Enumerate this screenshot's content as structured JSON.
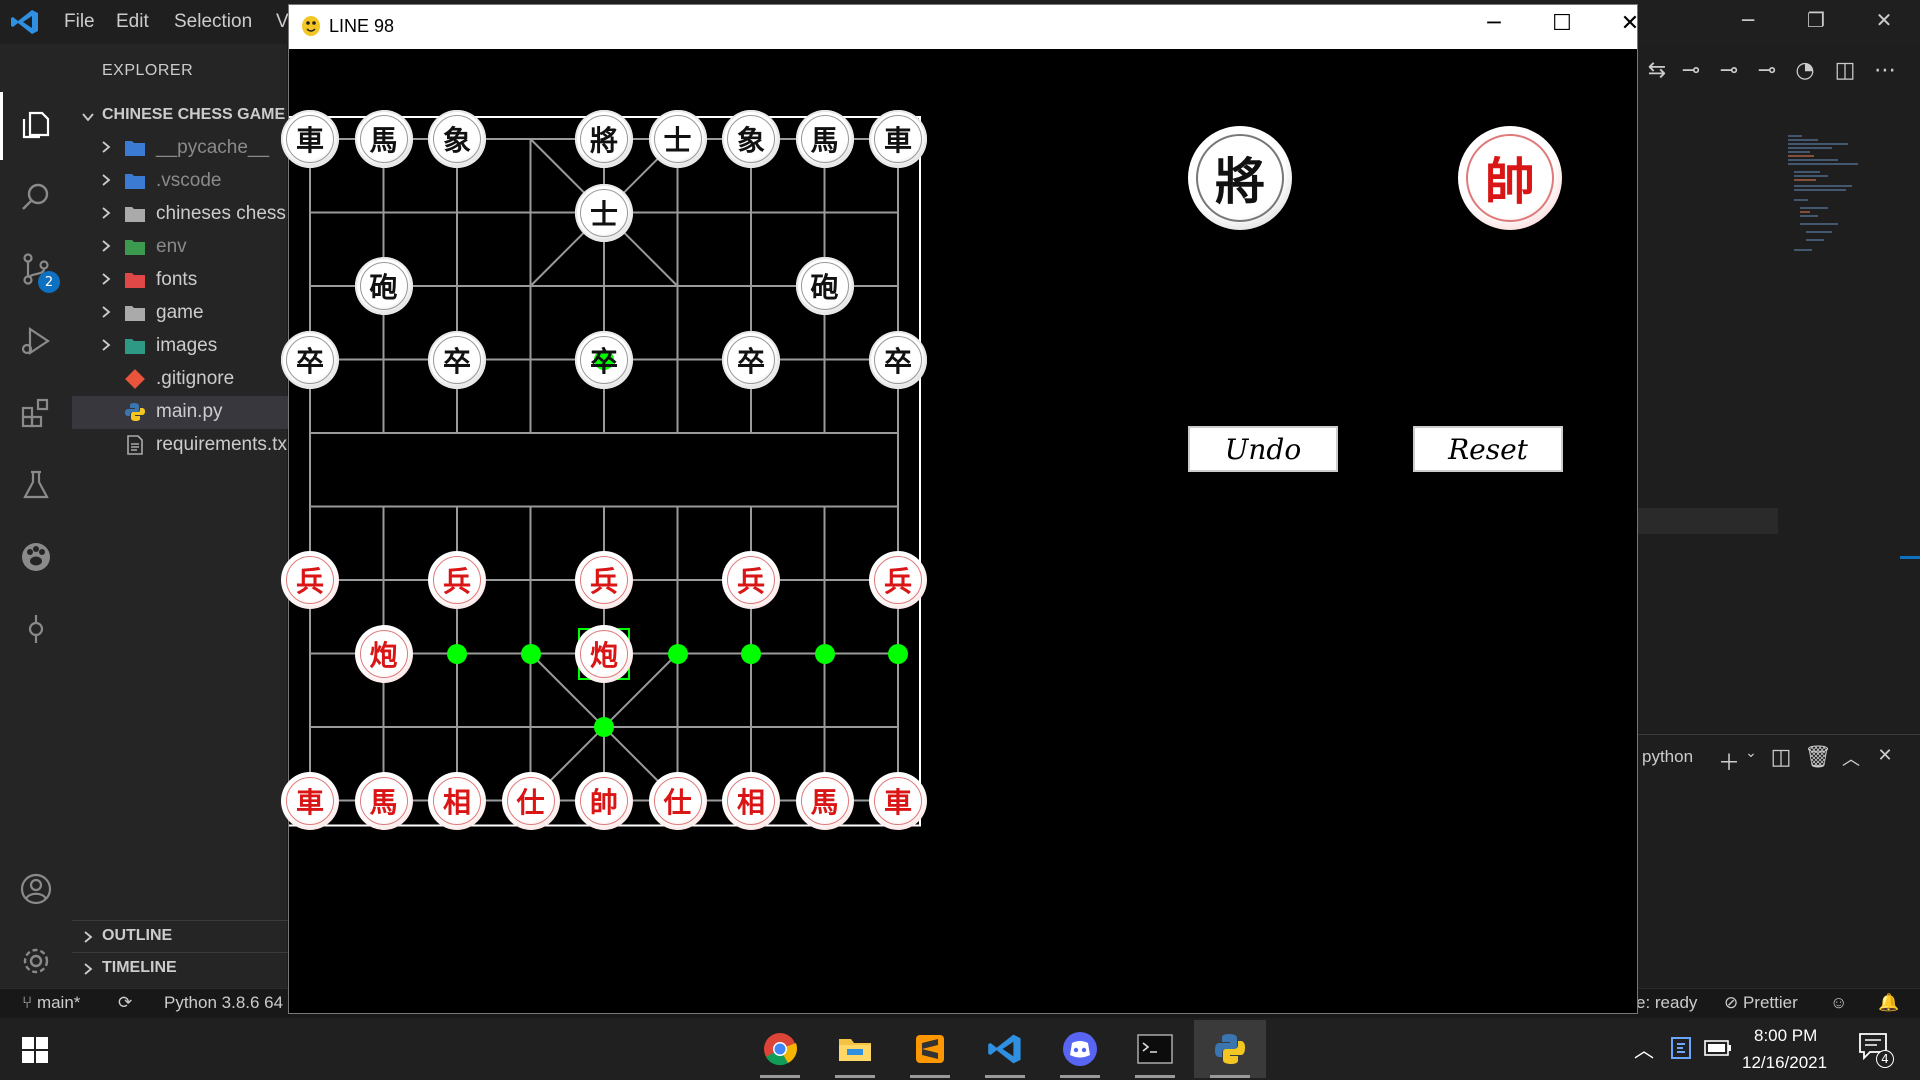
{
  "vscode": {
    "menu": [
      "File",
      "Edit",
      "Selection",
      "V"
    ],
    "explorer_title": "EXPLORER",
    "folder_name": "CHINESE CHESS GAME",
    "tree": [
      {
        "label": "__pycache__",
        "icon": "folder-python-icon",
        "color": "#8a8a8a"
      },
      {
        "label": ".vscode",
        "icon": "folder-vscode-icon",
        "color": "#8a8a8a"
      },
      {
        "label": "chineses chess",
        "icon": "folder-icon",
        "color": "#cccccc"
      },
      {
        "label": "env",
        "icon": "folder-env-icon",
        "color": "#8a8a8a"
      },
      {
        "label": "fonts",
        "icon": "folder-fonts-icon",
        "color": "#cccccc"
      },
      {
        "label": "game",
        "icon": "folder-icon",
        "color": "#cccccc"
      },
      {
        "label": "images",
        "icon": "folder-images-icon",
        "color": "#cccccc"
      },
      {
        "label": ".gitignore",
        "icon": "git-icon",
        "color": "#cccccc"
      },
      {
        "label": "main.py",
        "icon": "python-icon",
        "color": "#cccccc",
        "selected": true
      },
      {
        "label": "requirements.tx",
        "icon": "text-file-icon",
        "color": "#cccccc"
      }
    ],
    "outline": "OUTLINE",
    "timeline": "TIMELINE",
    "scm_badge": "2",
    "terminal_label": "python",
    "status": {
      "branch": "main*",
      "python": "Python 3.8.6 64",
      "ready": "e: ready",
      "prettier": "Prettier"
    }
  },
  "game": {
    "window_title": "LINE 98",
    "black_general": "將",
    "red_general": "帥",
    "undo_label": "Undo",
    "reset_label": "Reset",
    "pieces": [
      {
        "side": "black",
        "char": "車",
        "file": 0,
        "rank": 0
      },
      {
        "side": "black",
        "char": "馬",
        "file": 1,
        "rank": 0
      },
      {
        "side": "black",
        "char": "象",
        "file": 2,
        "rank": 0
      },
      {
        "side": "black",
        "char": "將",
        "file": 4,
        "rank": 0
      },
      {
        "side": "black",
        "char": "士",
        "file": 5,
        "rank": 0
      },
      {
        "side": "black",
        "char": "象",
        "file": 6,
        "rank": 0
      },
      {
        "side": "black",
        "char": "馬",
        "file": 7,
        "rank": 0
      },
      {
        "side": "black",
        "char": "車",
        "file": 8,
        "rank": 0
      },
      {
        "side": "black",
        "char": "士",
        "file": 4,
        "rank": 1
      },
      {
        "side": "black",
        "char": "砲",
        "file": 1,
        "rank": 2
      },
      {
        "side": "black",
        "char": "砲",
        "file": 7,
        "rank": 2
      },
      {
        "side": "black",
        "char": "卒",
        "file": 0,
        "rank": 3
      },
      {
        "side": "black",
        "char": "卒",
        "file": 2,
        "rank": 3
      },
      {
        "side": "black",
        "char": "卒",
        "file": 4,
        "rank": 3
      },
      {
        "side": "black",
        "char": "卒",
        "file": 6,
        "rank": 3
      },
      {
        "side": "black",
        "char": "卒",
        "file": 8,
        "rank": 3
      },
      {
        "side": "red",
        "char": "兵",
        "file": 0,
        "rank": 6
      },
      {
        "side": "red",
        "char": "兵",
        "file": 2,
        "rank": 6
      },
      {
        "side": "red",
        "char": "兵",
        "file": 4,
        "rank": 6
      },
      {
        "side": "red",
        "char": "兵",
        "file": 6,
        "rank": 6
      },
      {
        "side": "red",
        "char": "兵",
        "file": 8,
        "rank": 6
      },
      {
        "side": "red",
        "char": "炮",
        "file": 1,
        "rank": 7
      },
      {
        "side": "red",
        "char": "炮",
        "file": 4,
        "rank": 7
      },
      {
        "side": "red",
        "char": "車",
        "file": 0,
        "rank": 9
      },
      {
        "side": "red",
        "char": "馬",
        "file": 1,
        "rank": 9
      },
      {
        "side": "red",
        "char": "相",
        "file": 2,
        "rank": 9
      },
      {
        "side": "red",
        "char": "仕",
        "file": 3,
        "rank": 9
      },
      {
        "side": "red",
        "char": "帥",
        "file": 4,
        "rank": 9
      },
      {
        "side": "red",
        "char": "仕",
        "file": 5,
        "rank": 9
      },
      {
        "side": "red",
        "char": "相",
        "file": 6,
        "rank": 9
      },
      {
        "side": "red",
        "char": "馬",
        "file": 7,
        "rank": 9
      },
      {
        "side": "red",
        "char": "車",
        "file": 8,
        "rank": 9
      }
    ],
    "selected": {
      "file": 4,
      "rank": 7
    },
    "move_hints": [
      {
        "file": 4,
        "rank": 3
      },
      {
        "file": 2,
        "rank": 7
      },
      {
        "file": 3,
        "rank": 7
      },
      {
        "file": 5,
        "rank": 7
      },
      {
        "file": 6,
        "rank": 7
      },
      {
        "file": 7,
        "rank": 7
      },
      {
        "file": 8,
        "rank": 7
      },
      {
        "file": 4,
        "rank": 8
      }
    ],
    "colors": {
      "hint": "#00ff00",
      "red": "#d91515",
      "line": "#9a9a9a"
    }
  },
  "taskbar": {
    "apps": [
      "chrome-icon",
      "file-explorer-icon",
      "sublime-text-icon",
      "vscode-icon",
      "discord-icon",
      "terminal-icon",
      "python-icon"
    ],
    "time": "8:00 PM",
    "date": "12/16/2021",
    "notifications": "4"
  }
}
